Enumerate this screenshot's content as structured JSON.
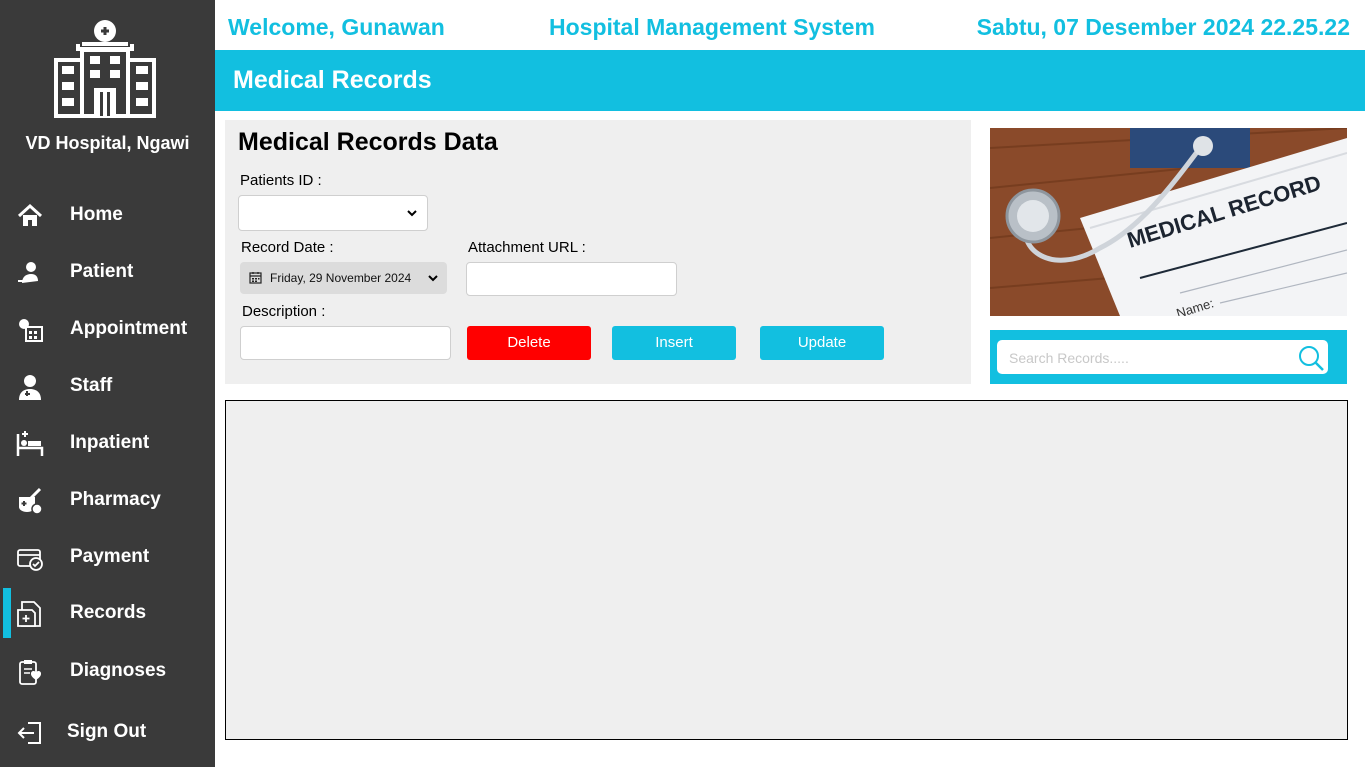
{
  "sidebar": {
    "hospital_name": "VD Hospital, Ngawi",
    "items": [
      {
        "label": "Home",
        "icon": "home-icon"
      },
      {
        "label": "Patient",
        "icon": "patient-icon"
      },
      {
        "label": "Appointment",
        "icon": "appointment-icon"
      },
      {
        "label": "Staff",
        "icon": "staff-icon"
      },
      {
        "label": "Inpatient",
        "icon": "inpatient-icon"
      },
      {
        "label": "Pharmacy",
        "icon": "pharmacy-icon"
      },
      {
        "label": "Payment",
        "icon": "payment-icon"
      },
      {
        "label": "Records",
        "icon": "records-icon",
        "active": true
      },
      {
        "label": "Diagnoses",
        "icon": "diagnoses-icon"
      }
    ],
    "sign_out": "Sign Out"
  },
  "header": {
    "welcome": "Welcome, Gunawan",
    "system_title": "Hospital Management System",
    "datetime": "Sabtu, 07 Desember 2024 22.25.22"
  },
  "page": {
    "title": "Medical Records"
  },
  "form": {
    "title": "Medical Records Data",
    "patients_id_label": "Patients ID :",
    "patients_id_value": "",
    "record_date_label": "Record Date :",
    "record_date_value": "Friday, 29 November 2024",
    "attachment_url_label": "Attachment URL :",
    "attachment_url_value": "",
    "description_label": "Description :",
    "description_value": "",
    "delete_label": "Delete",
    "insert_label": "Insert",
    "update_label": "Update"
  },
  "image": {
    "record_text": "MEDICAL RECORD",
    "form_field_text": "Name:"
  },
  "search": {
    "placeholder": "Search Records....."
  },
  "colors": {
    "accent": "#12bfe0",
    "sidebar": "#3a3a3a",
    "danger": "#ff0000",
    "panel": "#efefef"
  }
}
